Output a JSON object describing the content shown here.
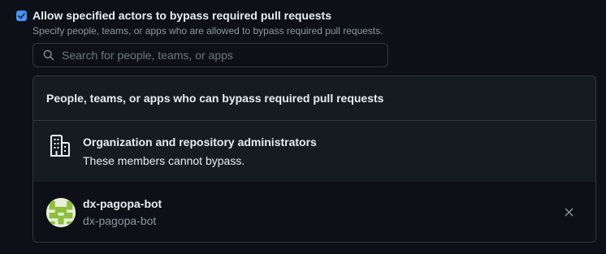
{
  "bypass_option": {
    "checked": true,
    "title": "Allow specified actors to bypass required pull requests",
    "description": "Specify people, teams, or apps who are allowed to bypass required pull requests."
  },
  "search": {
    "placeholder": "Search for people, teams, or apps",
    "value": "",
    "icon": "search-icon"
  },
  "actors_panel": {
    "header": "People, teams, or apps who can bypass required pull requests",
    "admins": {
      "icon": "organization-icon",
      "title": "Organization and repository administrators",
      "subtitle": "These members cannot bypass."
    },
    "actors": [
      {
        "name": "dx-pagopa-bot",
        "login": "dx-pagopa-bot",
        "avatar_color": "#8dbf3c",
        "remove_icon": "close-icon"
      }
    ]
  },
  "colors": {
    "background": "#0d1117",
    "accent": "#4493f8",
    "border": "#30363d",
    "muted_text": "#8d96a0"
  }
}
